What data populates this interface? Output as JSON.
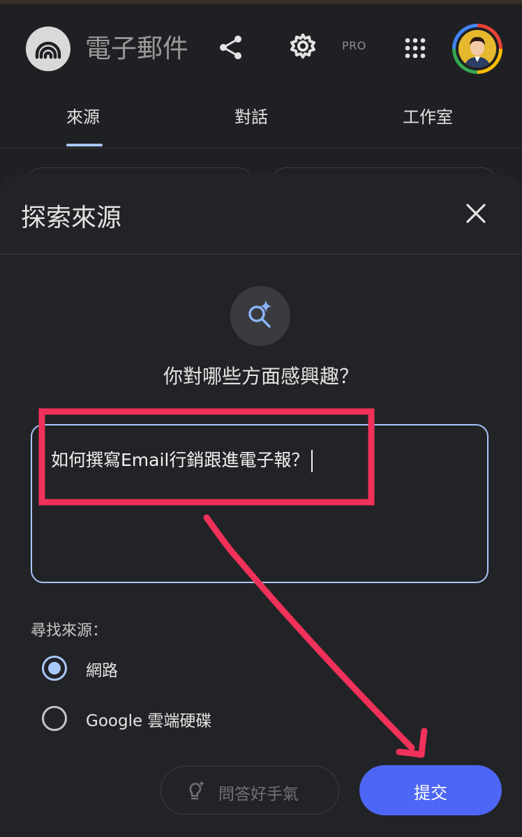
{
  "app": {
    "notebook_title": "電子郵件",
    "pro_badge": "PRO"
  },
  "tabs": [
    {
      "label": "來源",
      "active": true
    },
    {
      "label": "對話",
      "active": false
    },
    {
      "label": "工作室",
      "active": false
    }
  ],
  "dialog": {
    "title": "探索來源",
    "question": "你對哪些方面感興趣？",
    "input_value": "如何撰寫Email行銷跟進電子報？",
    "find_sources_label": "尋找來源：",
    "options": [
      {
        "label": "網路",
        "selected": true
      },
      {
        "label": "Google 雲端硬碟",
        "selected": false
      }
    ],
    "feeling_lucky_label": "問答好手氣",
    "submit_label": "提交"
  },
  "colors": {
    "background": "#1f2023",
    "sheet": "#222326",
    "accent": "#a8c7fa",
    "submit": "#4d66f5",
    "annotation": "#f0315a"
  },
  "icons": [
    "notebook-logo-icon",
    "share-icon",
    "gear-icon",
    "apps-grid-icon",
    "close-icon",
    "search-spark-icon",
    "lightbulb-spark-icon"
  ]
}
